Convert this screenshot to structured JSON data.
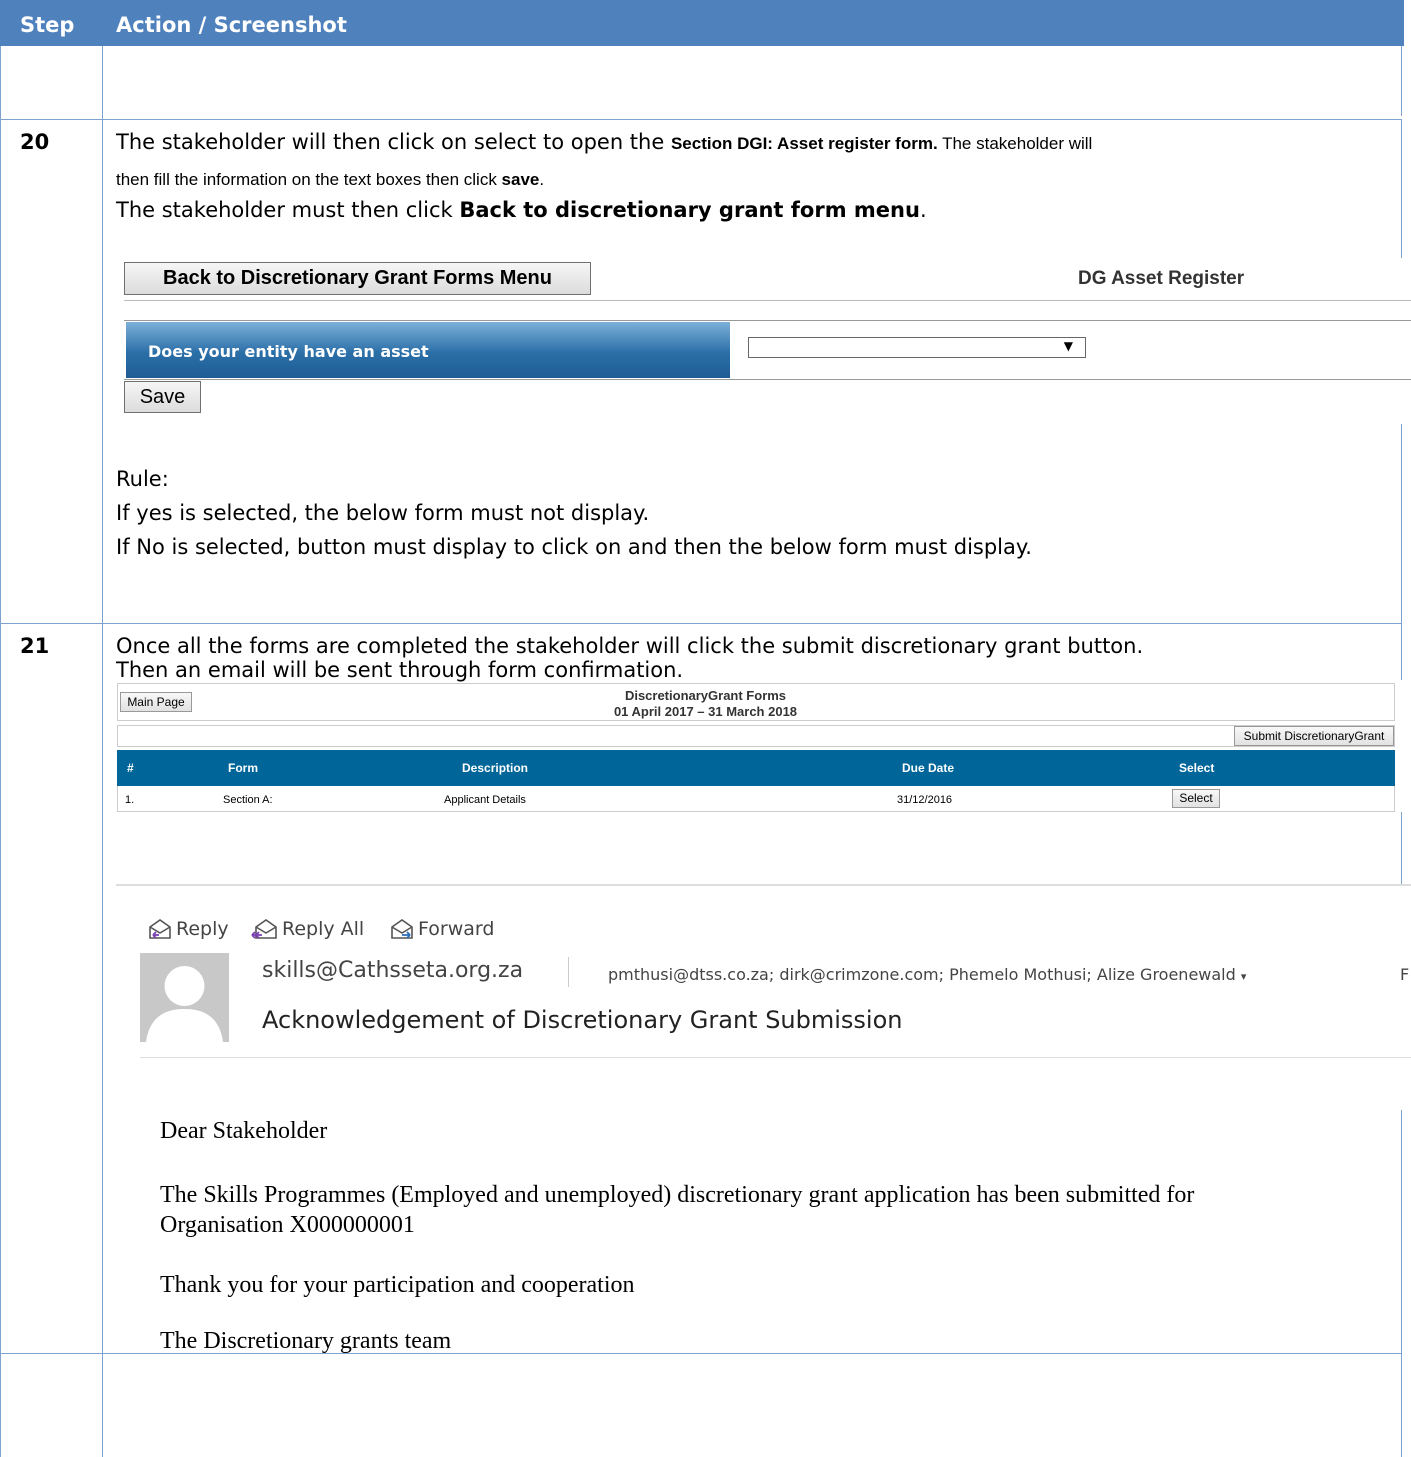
{
  "table": {
    "col_step": "Step",
    "col_action": "Action / Screenshot"
  },
  "step20": {
    "num": "20",
    "line1_a": "The stakeholder will then click on select to open the ",
    "line1_b": "Section DGI: Asset register form.",
    "line1_c": "  The stakeholder will",
    "line2_a": "then fill the information on the text boxes then click ",
    "line2_b": "save",
    "line2_c": ".",
    "line3_a": "The stakeholder must then click ",
    "line3_b": "Back to discretionary grant form menu",
    "line3_c": ".",
    "rule_title": "Rule:",
    "rule_1": "If yes is selected, the below form must not display.",
    "rule_2": "If No is selected, button must display to click on and then the below form must display."
  },
  "asset_form": {
    "back_button": "Back to Discretionary Grant Forms Menu",
    "title": "DG Asset Register",
    "question": "Does your entity have an asset",
    "select_value": "",
    "save_button": "Save"
  },
  "step21": {
    "num": "21",
    "line1": "Once all the forms are completed the stakeholder will click the submit discretionary grant button.",
    "line2": "Then an email will be sent through form confirmation."
  },
  "grant_forms": {
    "main_page_button": "Main Page",
    "title": "DiscretionaryGrant Forms",
    "period": "01 April 2017 – 31 March 2018",
    "submit_button": "Submit DiscretionaryGrant",
    "columns": [
      "#",
      "Form",
      "Description",
      "Due Date",
      "Select"
    ],
    "rows": [
      {
        "num": "1.",
        "form": "Section A:",
        "description": "Applicant Details",
        "due": "31/12/2016",
        "select": "Select"
      }
    ]
  },
  "email": {
    "reply": "Reply",
    "reply_all": "Reply All",
    "forward": "Forward",
    "from": "skills@Cathsseta.org.za",
    "to": "pmthusi@dtss.co.za; dirk@crimzone.com; Phemelo Mothusi; Alize Groenewald",
    "to_more": "F",
    "subject": "Acknowledgement of Discretionary Grant Submission",
    "greeting": "Dear Stakeholder",
    "body_1": "The Skills Programmes (Employed and unemployed) discretionary grant application has been submitted for",
    "body_2": "Organisation X000000001",
    "body_3": "Thank you for your participation and cooperation",
    "signoff": "The Discretionary grants team"
  },
  "icons": [
    "reply-icon",
    "reply-all-icon",
    "forward-icon",
    "avatar-icon",
    "dropdown-arrow-icon"
  ]
}
